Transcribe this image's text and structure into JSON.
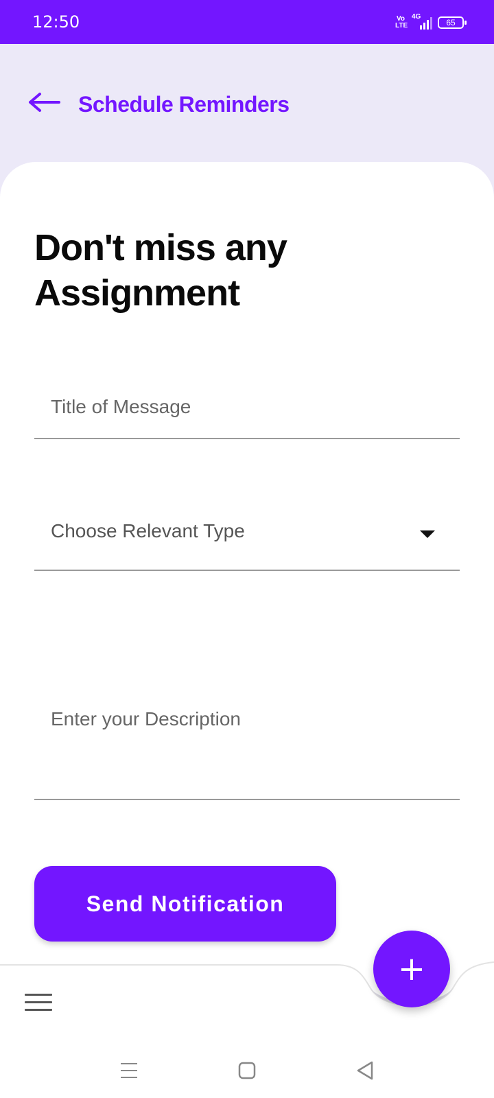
{
  "status_bar": {
    "time": "12:50",
    "volte": "Vo LTE",
    "network": "4G",
    "battery": "65"
  },
  "app_bar": {
    "back_icon": "arrow-left-icon",
    "title": "Schedule Reminders"
  },
  "form": {
    "headline": "Don't miss any Assignment",
    "title_placeholder": "Title of Message",
    "type_placeholder": "Choose Relevant Type",
    "description_placeholder": "Enter your Description",
    "submit_label": "Send Notification"
  },
  "bottom_bar": {
    "menu_icon": "hamburger-menu-icon",
    "fab_label": "+"
  },
  "system_nav": {
    "recents_icon": "recents-icon",
    "home_icon": "home-icon",
    "back_icon": "back-triangle-icon"
  },
  "colors": {
    "accent": "#7316ff",
    "background": "#ece9f8",
    "card": "#ffffff"
  }
}
